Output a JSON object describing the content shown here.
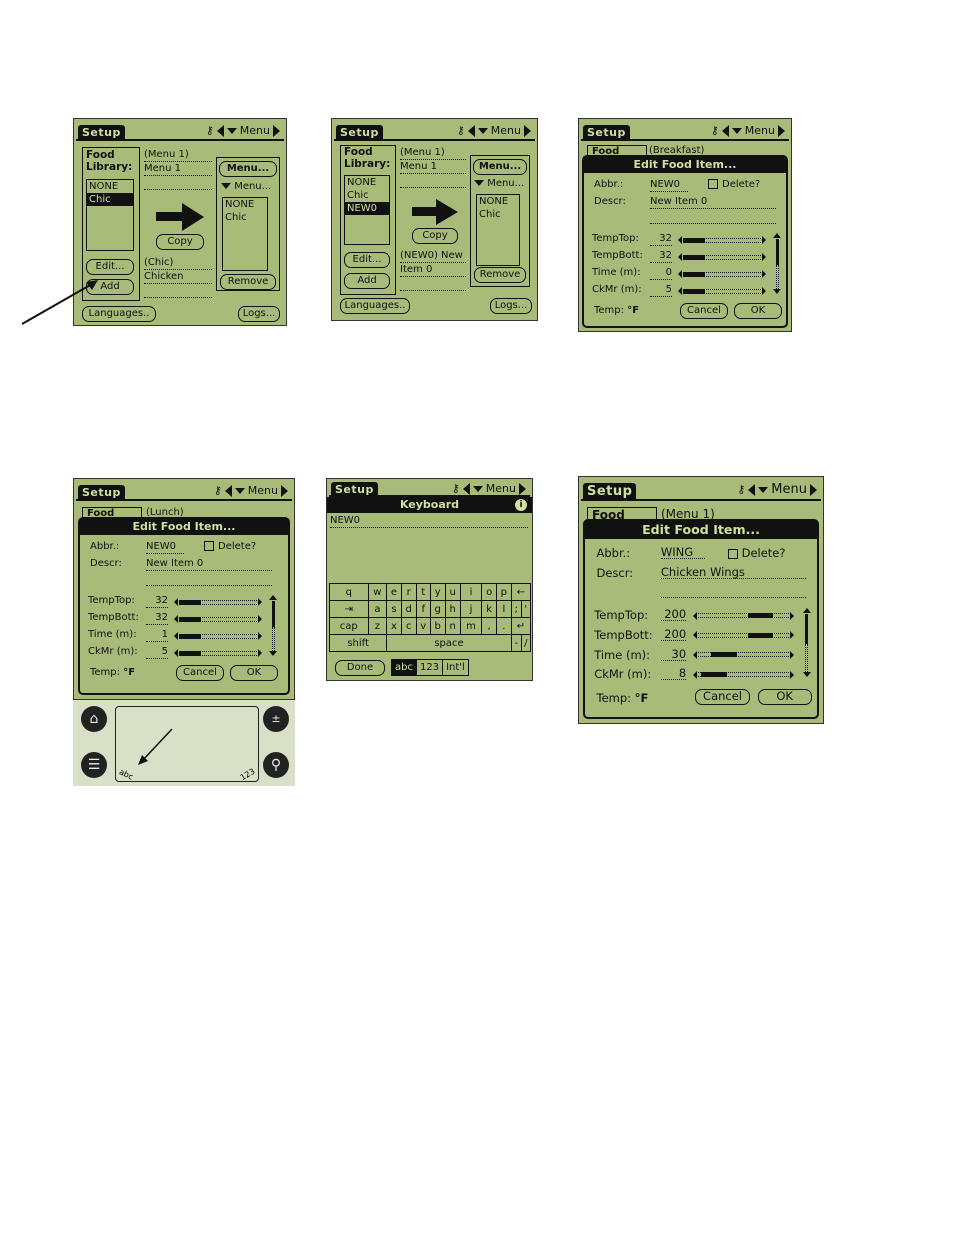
{
  "colors": {
    "lcd_bg": "#a8bb78",
    "ink": "#111111",
    "inverse_text": "#cfe0a0",
    "page_bg": "#ffffff"
  },
  "common": {
    "tab_label": "Setup",
    "menu_label": "Menu",
    "icons": {
      "key": "key-icon",
      "left": "triangle-left-icon",
      "down": "triangle-down-icon",
      "right": "triangle-right-icon"
    }
  },
  "screens": [
    {
      "id": "setup-1",
      "food_library_label": "Food Library:",
      "library_items": [
        "NONE",
        "Chic"
      ],
      "library_selected": "Chic",
      "menu_name_1": "(Menu 1)",
      "menu_name_2": "Menu 1",
      "menu_button": "Menu...",
      "menu_dropdown": "Menu...",
      "menu_items": [
        "NONE",
        "Chic"
      ],
      "copy_button": "Copy",
      "item_line_1": "(Chic)",
      "item_line_2": "Chicken",
      "edit_button": "Edit...",
      "add_button": "Add",
      "remove_button": "Remove",
      "languages_button": "Languages..",
      "logs_button": "Logs..."
    },
    {
      "id": "setup-2",
      "food_library_label": "Food Library:",
      "library_items": [
        "NONE",
        "Chic",
        "NEW0"
      ],
      "library_selected": "NEW0",
      "menu_name_1": "(Menu 1)",
      "menu_name_2": "Menu 1",
      "menu_button": "Menu...",
      "menu_dropdown": "Menu...",
      "menu_items": [
        "NONE",
        "Chic"
      ],
      "copy_button": "Copy",
      "item_line_1": "(NEW0) New",
      "item_line_2": "Item 0",
      "edit_button": "Edit...",
      "add_button": "Add",
      "remove_button": "Remove",
      "languages_button": "Languages..",
      "logs_button": "Logs..."
    },
    {
      "id": "edit-1",
      "bg_label": "Food",
      "bg_text": "(Breakfast)",
      "title": "Edit Food Item...",
      "abbr_label": "Abbr.:",
      "abbr_value": "NEW0",
      "delete_label": "Delete?",
      "descr_label": "Descr:",
      "descr_value": "New Item 0",
      "fields": [
        {
          "label": "TempTop:",
          "value": "32",
          "slider": 0.0
        },
        {
          "label": "TempBott:",
          "value": "32",
          "slider": 0.0
        },
        {
          "label": "Time (m):",
          "value": "0",
          "slider": 0.0
        },
        {
          "label": "CkMr (m):",
          "value": "5",
          "slider": 0.0
        }
      ],
      "temp_label": "Temp:",
      "temp_unit": "°F",
      "cancel": "Cancel",
      "ok": "OK"
    },
    {
      "id": "edit-2",
      "bg_label": "Food",
      "bg_text": "(Lunch)",
      "title": "Edit Food Item...",
      "abbr_label": "Abbr.:",
      "abbr_value": "NEW0",
      "delete_label": "Delete?",
      "descr_label": "Descr:",
      "descr_value": "New Item 0",
      "fields": [
        {
          "label": "TempTop:",
          "value": "32",
          "slider": 0.0
        },
        {
          "label": "TempBott:",
          "value": "32",
          "slider": 0.0
        },
        {
          "label": "Time (m):",
          "value": "1",
          "slider": 0.0
        },
        {
          "label": "CkMr (m):",
          "value": "5",
          "slider": 0.0
        }
      ],
      "temp_label": "Temp:",
      "temp_unit": "°F",
      "cancel": "Cancel",
      "ok": "OK",
      "graffiti": {
        "abc": "abc",
        "num": "123"
      }
    },
    {
      "id": "keyboard",
      "title": "Keyboard",
      "text_value": "NEW0",
      "rows": [
        [
          "q",
          "w",
          "e",
          "r",
          "t",
          "y",
          "u",
          "i",
          "o",
          "p",
          "←"
        ],
        [
          "⇥",
          "a",
          "s",
          "d",
          "f",
          "g",
          "h",
          "j",
          "k",
          "l",
          ";",
          "'"
        ],
        [
          "cap",
          "z",
          "x",
          "c",
          "v",
          "b",
          "n",
          "m",
          ",",
          ".",
          "↵"
        ],
        [
          "shift",
          "space",
          "-",
          "/"
        ]
      ],
      "done": "Done",
      "modes": [
        "abc",
        "123",
        "Int'l"
      ],
      "mode_selected": "abc"
    },
    {
      "id": "edit-3",
      "bg_label": "Food",
      "bg_text": "(Menu 1)",
      "title": "Edit Food Item...",
      "abbr_label": "Abbr.:",
      "abbr_value": "WING",
      "delete_label": "Delete?",
      "descr_label": "Descr:",
      "descr_value": "Chicken Wings",
      "fields": [
        {
          "label": "TempTop:",
          "value": "200",
          "slider": 0.75
        },
        {
          "label": "TempBott:",
          "value": "200",
          "slider": 0.75
        },
        {
          "label": "Time (m):",
          "value": "30",
          "slider": 0.2
        },
        {
          "label": "CkMr (m):",
          "value": "8",
          "slider": 0.05
        }
      ],
      "temp_label": "Temp:",
      "temp_unit": "°F",
      "cancel": "Cancel",
      "ok": "OK"
    }
  ]
}
